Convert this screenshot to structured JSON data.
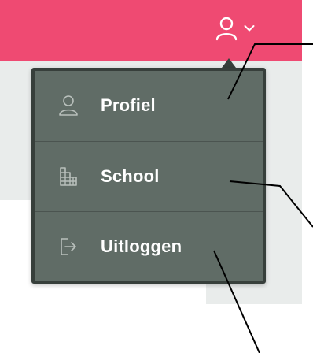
{
  "header": {
    "background": "#ef4a72",
    "user_icon": "user-icon",
    "dropdown_icon": "chevron-down-icon"
  },
  "menu": {
    "background": "#606c66",
    "border": "#373f3b",
    "items": [
      {
        "label": "Profiel",
        "icon": "user-icon"
      },
      {
        "label": "School",
        "icon": "building-icon"
      },
      {
        "label": "Uitloggen",
        "icon": "logout-icon"
      }
    ]
  }
}
